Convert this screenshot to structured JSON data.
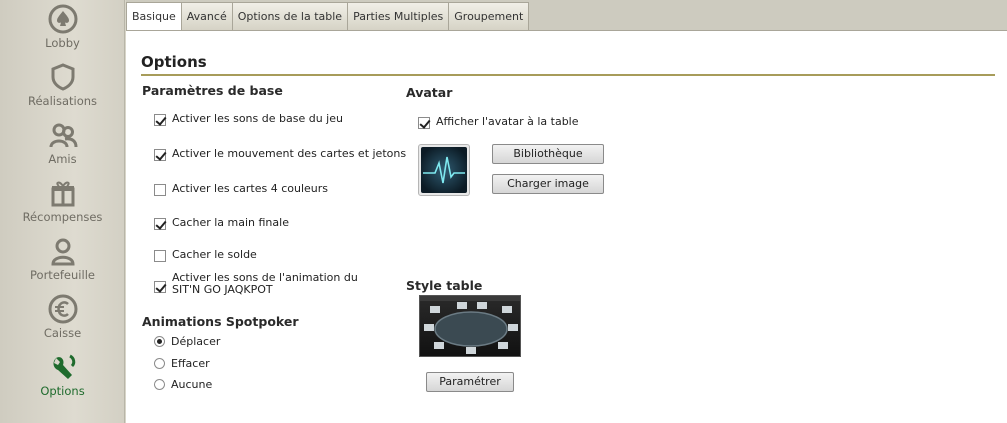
{
  "sidebar": {
    "items": [
      {
        "label": "Lobby",
        "icon": "spade-icon",
        "active": false
      },
      {
        "label": "Réalisations",
        "icon": "shield-icon",
        "active": false
      },
      {
        "label": "Amis",
        "icon": "friends-icon",
        "active": false
      },
      {
        "label": "Récompenses",
        "icon": "gift-icon",
        "active": false
      },
      {
        "label": "Portefeuille",
        "icon": "wallet-icon",
        "active": false
      },
      {
        "label": "Caisse",
        "icon": "euro-icon",
        "active": false
      },
      {
        "label": "Options",
        "icon": "wrench-icon",
        "active": true
      }
    ]
  },
  "tabs": [
    "Basique",
    "Avancé",
    "Options de la table",
    "Parties Multiples",
    "Groupement"
  ],
  "active_tab": "Basique",
  "page": {
    "title": "Options"
  },
  "basic": {
    "heading": "Paramètres de base",
    "options": [
      {
        "label": "Activer les sons de base du jeu",
        "checked": true
      },
      {
        "label": "Activer le mouvement des cartes et jetons",
        "checked": true
      },
      {
        "label": "Activer les cartes 4 couleurs",
        "checked": false
      },
      {
        "label": "Cacher la main finale",
        "checked": true
      },
      {
        "label": "Cacher le solde",
        "checked": false
      },
      {
        "label": "Activer les sons de l'animation du SIT'N GO JAQKPOT",
        "checked": true
      }
    ]
  },
  "animations": {
    "heading": "Animations Spotpoker",
    "options": [
      {
        "label": "Déplacer",
        "selected": true
      },
      {
        "label": "Effacer",
        "selected": false
      },
      {
        "label": "Aucune",
        "selected": false
      }
    ]
  },
  "avatar": {
    "heading": "Avatar",
    "show_label": "Afficher l'avatar à la table",
    "show_checked": true,
    "library_button": "Bibliothèque",
    "upload_button": "Charger image"
  },
  "table_style": {
    "heading": "Style table",
    "configure_button": "Paramétrer"
  },
  "colors": {
    "active_green": "#1f6b2d",
    "sidebar_text": "#6f6c63",
    "title_rule": "#a79c5a"
  }
}
